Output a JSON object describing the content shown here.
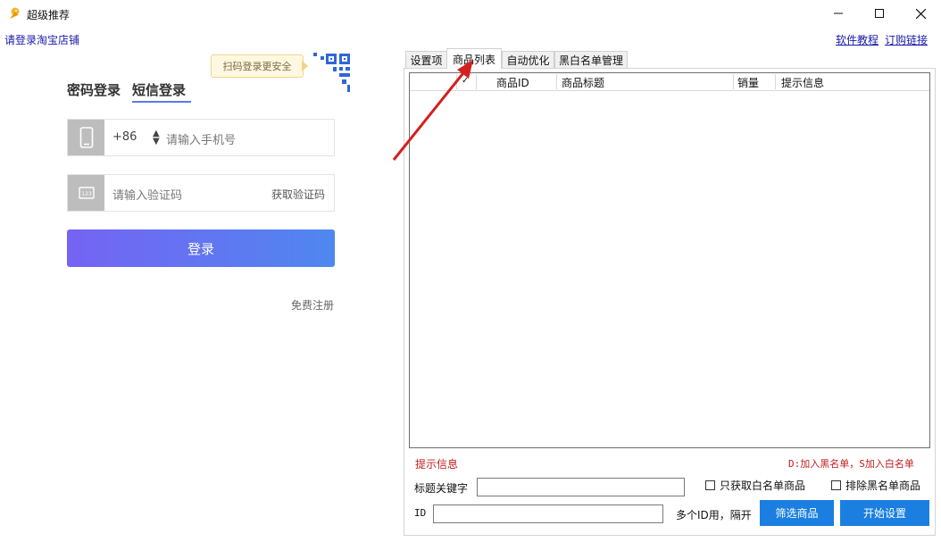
{
  "window": {
    "title": "超级推荐",
    "minimize": "—",
    "maximize": "☐",
    "close": "✕"
  },
  "header": {
    "login_shop_link": "请登录淘宝店铺",
    "tutorial_link": "软件教程",
    "order_link": "订购链接"
  },
  "login": {
    "qr_tip": "扫码登录更安全",
    "tabs": [
      "密码登录",
      "短信登录"
    ],
    "active_tab": "短信登录",
    "country_code": "+86",
    "phone_placeholder": "请输入手机号",
    "code_placeholder": "请输入验证码",
    "get_code": "获取验证码",
    "login_button": "登录",
    "register": "免费注册"
  },
  "tabs": {
    "items": [
      "设置项",
      "商品列表",
      "自动优化",
      "黑白名单管理"
    ],
    "active": "商品列表"
  },
  "grid": {
    "columns": [
      "",
      "✓",
      "商品ID",
      "商品标题",
      "销量",
      "提示信息"
    ],
    "rows": []
  },
  "bottom": {
    "hint_label": "提示信息",
    "blacklist_hint": "D:加入黑名单，S加入白名单",
    "title_keyword_label": "标题关键字",
    "title_keyword_value": "",
    "only_whitelist": "只获取白名单商品",
    "exclude_blacklist": "排除黑名单商品",
    "id_label": "ID",
    "id_value": "",
    "multi_id_hint": "多个ID用，隔开",
    "filter_button": "筛选商品",
    "start_button": "开始设置"
  },
  "colors": {
    "link": "#1a1aa8",
    "accent_blue": "#1a7fe0",
    "hint_red": "#c01d1d",
    "annotation_arrow": "#d42020"
  }
}
